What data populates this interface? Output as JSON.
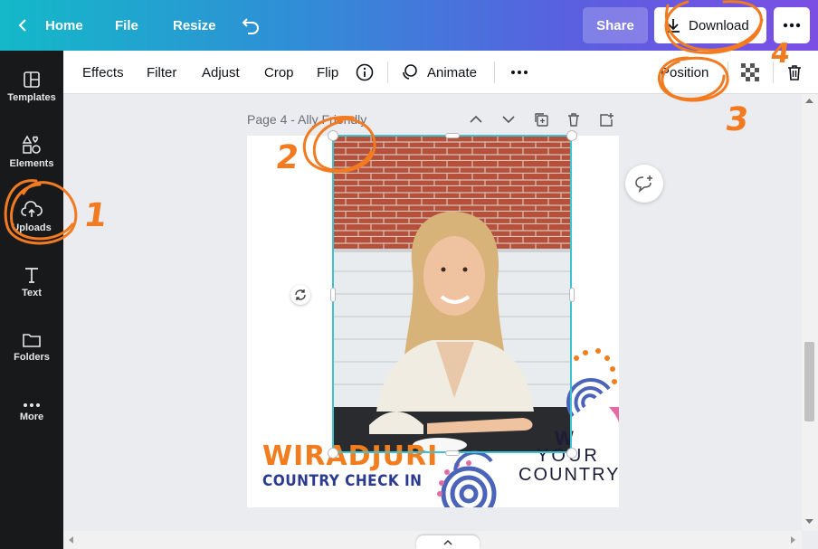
{
  "topbar": {
    "home_label": "Home",
    "file_label": "File",
    "resize_label": "Resize",
    "share_label": "Share",
    "download_label": "Download"
  },
  "sidebar": {
    "items": [
      {
        "label": "Templates",
        "icon": "templates-icon"
      },
      {
        "label": "Elements",
        "icon": "elements-icon"
      },
      {
        "label": "Uploads",
        "icon": "upload-cloud-icon"
      },
      {
        "label": "Text",
        "icon": "text-icon"
      },
      {
        "label": "Folders",
        "icon": "folder-icon"
      },
      {
        "label": "More",
        "icon": "more-dots-icon"
      }
    ]
  },
  "toolbar": {
    "effects_label": "Effects",
    "filter_label": "Filter",
    "adjust_label": "Adjust",
    "crop_label": "Crop",
    "flip_label": "Flip",
    "animate_label": "Animate",
    "position_label": "Position"
  },
  "page": {
    "label": "Page 4 - Ally Friendly"
  },
  "design": {
    "title": "WIRADJURI",
    "subtitle": "COUNTRY CHECK IN",
    "know_line1": "W",
    "know_line2": "YOUR",
    "know_line3": "COUNTRY"
  },
  "annotations": {
    "n1": "1",
    "n2": "2",
    "n3": "3",
    "n4": "4"
  },
  "colors": {
    "accent_orange": "#f27b21",
    "selection": "#3ec3d0",
    "title_orange": "#f17d1f",
    "subtitle_blue": "#2a3a8f"
  }
}
